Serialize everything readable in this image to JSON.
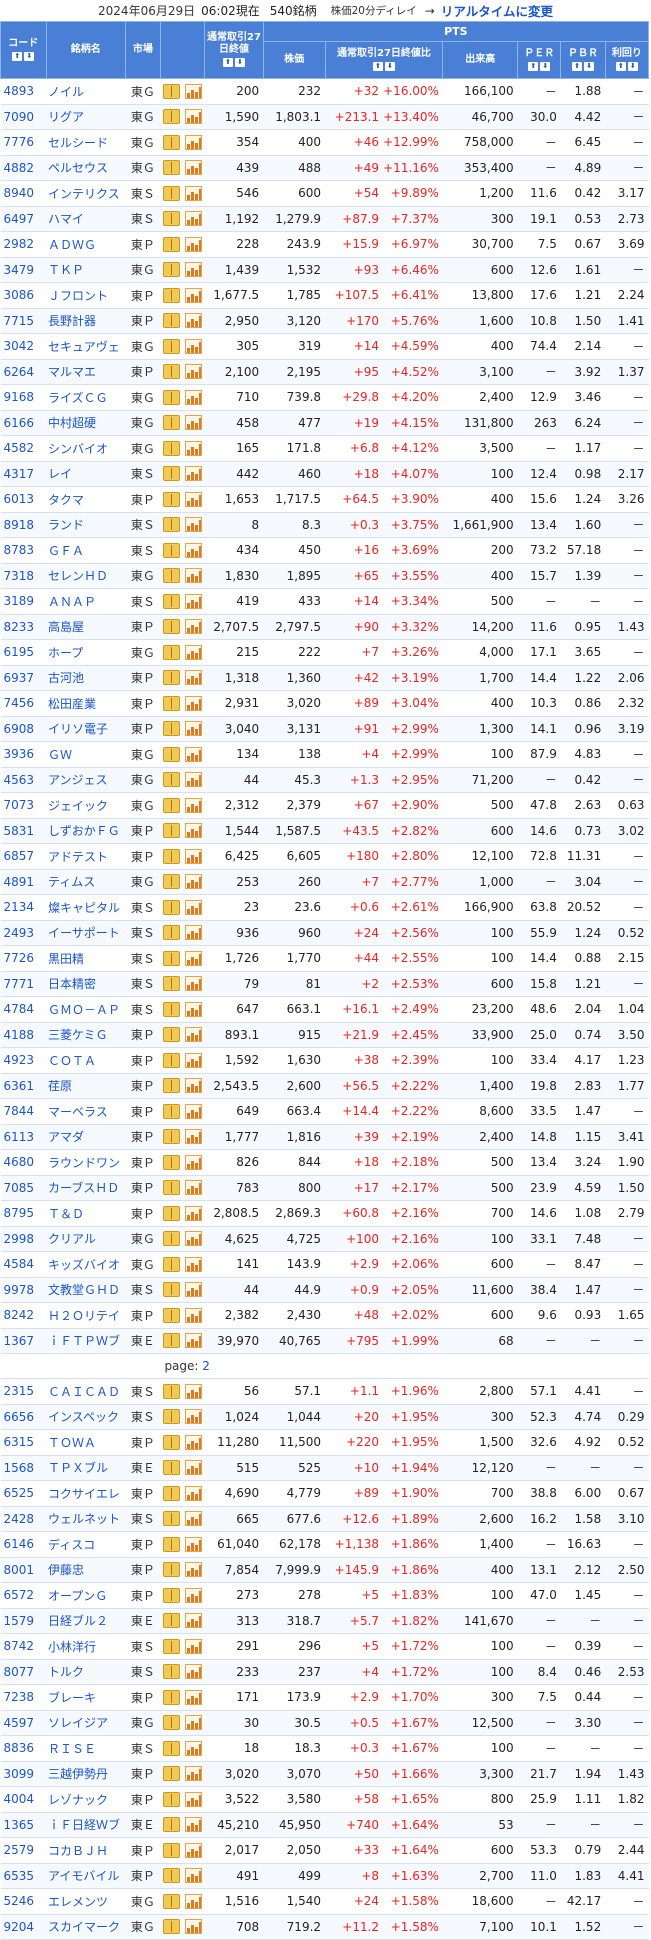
{
  "header": {
    "date": "2024年06月29日",
    "time": "06:02現在",
    "count": "540銘柄",
    "delay": "株価20分ディレイ",
    "arrow": "→",
    "realtime_link": "リアルタイムに変更"
  },
  "columns": {
    "code": "コード",
    "name": "銘柄名",
    "market": "市場",
    "prev_close": "通常取引27日終値",
    "pts_group": "PTS",
    "price": "株価",
    "change": "通常取引27日終値比",
    "volume": "出来高",
    "per": "ＰＥＲ",
    "pbr": "ＰＢＲ",
    "yield": "利回り",
    "sort_up": "⬆",
    "sort_down": "⬇"
  },
  "page_label": "page:",
  "page_link": "2",
  "rows": [
    {
      "code": "4893",
      "name": "ノイル",
      "market": "東Ｇ",
      "prev": "200",
      "price": "232",
      "chg": "+32",
      "pct": "+16.00%",
      "vol": "166,100",
      "per": "－",
      "pbr": "1.88",
      "yld": "－"
    },
    {
      "code": "7090",
      "name": "リグア",
      "market": "東Ｇ",
      "prev": "1,590",
      "price": "1,803.1",
      "chg": "+213.1",
      "pct": "+13.40%",
      "vol": "46,700",
      "per": "30.0",
      "pbr": "4.42",
      "yld": "－"
    },
    {
      "code": "7776",
      "name": "セルシード",
      "market": "東Ｇ",
      "prev": "354",
      "price": "400",
      "chg": "+46",
      "pct": "+12.99%",
      "vol": "758,000",
      "per": "－",
      "pbr": "6.45",
      "yld": "－"
    },
    {
      "code": "4882",
      "name": "ペルセウス",
      "market": "東Ｇ",
      "prev": "439",
      "price": "488",
      "chg": "+49",
      "pct": "+11.16%",
      "vol": "353,400",
      "per": "－",
      "pbr": "4.89",
      "yld": "－"
    },
    {
      "code": "8940",
      "name": "インテリクス",
      "market": "東Ｓ",
      "prev": "546",
      "price": "600",
      "chg": "+54",
      "pct": "+9.89%",
      "vol": "1,200",
      "per": "11.6",
      "pbr": "0.42",
      "yld": "3.17"
    },
    {
      "code": "6497",
      "name": "ハマイ",
      "market": "東Ｓ",
      "prev": "1,192",
      "price": "1,279.9",
      "chg": "+87.9",
      "pct": "+7.37%",
      "vol": "300",
      "per": "19.1",
      "pbr": "0.53",
      "yld": "2.73"
    },
    {
      "code": "2982",
      "name": "ＡＤＷＧ",
      "market": "東Ｐ",
      "prev": "228",
      "price": "243.9",
      "chg": "+15.9",
      "pct": "+6.97%",
      "vol": "30,700",
      "per": "7.5",
      "pbr": "0.67",
      "yld": "3.69"
    },
    {
      "code": "3479",
      "name": "ＴＫＰ",
      "market": "東Ｇ",
      "prev": "1,439",
      "price": "1,532",
      "chg": "+93",
      "pct": "+6.46%",
      "vol": "600",
      "per": "12.6",
      "pbr": "1.61",
      "yld": "－"
    },
    {
      "code": "3086",
      "name": "Ｊフロント",
      "market": "東Ｐ",
      "prev": "1,677.5",
      "price": "1,785",
      "chg": "+107.5",
      "pct": "+6.41%",
      "vol": "13,800",
      "per": "17.6",
      "pbr": "1.21",
      "yld": "2.24"
    },
    {
      "code": "7715",
      "name": "長野計器",
      "market": "東Ｐ",
      "prev": "2,950",
      "price": "3,120",
      "chg": "+170",
      "pct": "+5.76%",
      "vol": "1,600",
      "per": "10.8",
      "pbr": "1.50",
      "yld": "1.41"
    },
    {
      "code": "3042",
      "name": "セキュアヴェ",
      "market": "東Ｇ",
      "prev": "305",
      "price": "319",
      "chg": "+14",
      "pct": "+4.59%",
      "vol": "400",
      "per": "74.4",
      "pbr": "2.14",
      "yld": "－"
    },
    {
      "code": "6264",
      "name": "マルマエ",
      "market": "東Ｐ",
      "prev": "2,100",
      "price": "2,195",
      "chg": "+95",
      "pct": "+4.52%",
      "vol": "3,100",
      "per": "－",
      "pbr": "3.92",
      "yld": "1.37"
    },
    {
      "code": "9168",
      "name": "ライズＣＧ",
      "market": "東Ｇ",
      "prev": "710",
      "price": "739.8",
      "chg": "+29.8",
      "pct": "+4.20%",
      "vol": "2,400",
      "per": "12.9",
      "pbr": "3.46",
      "yld": "－"
    },
    {
      "code": "6166",
      "name": "中村超硬",
      "market": "東Ｇ",
      "prev": "458",
      "price": "477",
      "chg": "+19",
      "pct": "+4.15%",
      "vol": "131,800",
      "per": "263",
      "pbr": "6.24",
      "yld": "－"
    },
    {
      "code": "4582",
      "name": "シンバイオ",
      "market": "東Ｇ",
      "prev": "165",
      "price": "171.8",
      "chg": "+6.8",
      "pct": "+4.12%",
      "vol": "3,500",
      "per": "－",
      "pbr": "1.17",
      "yld": "－"
    },
    {
      "code": "4317",
      "name": "レイ",
      "market": "東Ｓ",
      "prev": "442",
      "price": "460",
      "chg": "+18",
      "pct": "+4.07%",
      "vol": "100",
      "per": "12.4",
      "pbr": "0.98",
      "yld": "2.17"
    },
    {
      "code": "6013",
      "name": "タクマ",
      "market": "東Ｐ",
      "prev": "1,653",
      "price": "1,717.5",
      "chg": "+64.5",
      "pct": "+3.90%",
      "vol": "400",
      "per": "15.6",
      "pbr": "1.24",
      "yld": "3.26"
    },
    {
      "code": "8918",
      "name": "ランド",
      "market": "東Ｓ",
      "prev": "8",
      "price": "8.3",
      "chg": "+0.3",
      "pct": "+3.75%",
      "vol": "1,661,900",
      "per": "13.4",
      "pbr": "1.60",
      "yld": "－"
    },
    {
      "code": "8783",
      "name": "ＧＦＡ",
      "market": "東Ｓ",
      "prev": "434",
      "price": "450",
      "chg": "+16",
      "pct": "+3.69%",
      "vol": "200",
      "per": "73.2",
      "pbr": "57.18",
      "yld": "－"
    },
    {
      "code": "7318",
      "name": "セレンＨＤ",
      "market": "東Ｇ",
      "prev": "1,830",
      "price": "1,895",
      "chg": "+65",
      "pct": "+3.55%",
      "vol": "400",
      "per": "15.7",
      "pbr": "1.39",
      "yld": "－"
    },
    {
      "code": "3189",
      "name": "ＡＮＡＰ",
      "market": "東Ｓ",
      "prev": "419",
      "price": "433",
      "chg": "+14",
      "pct": "+3.34%",
      "vol": "500",
      "per": "－",
      "pbr": "－",
      "yld": "－"
    },
    {
      "code": "8233",
      "name": "高島屋",
      "market": "東Ｐ",
      "prev": "2,707.5",
      "price": "2,797.5",
      "chg": "+90",
      "pct": "+3.32%",
      "vol": "14,200",
      "per": "11.6",
      "pbr": "0.95",
      "yld": "1.43"
    },
    {
      "code": "6195",
      "name": "ホープ",
      "market": "東Ｇ",
      "prev": "215",
      "price": "222",
      "chg": "+7",
      "pct": "+3.26%",
      "vol": "4,000",
      "per": "17.1",
      "pbr": "3.65",
      "yld": "－"
    },
    {
      "code": "6937",
      "name": "古河池",
      "market": "東Ｐ",
      "prev": "1,318",
      "price": "1,360",
      "chg": "+42",
      "pct": "+3.19%",
      "vol": "1,700",
      "per": "14.4",
      "pbr": "1.22",
      "yld": "2.06"
    },
    {
      "code": "7456",
      "name": "松田産業",
      "market": "東Ｐ",
      "prev": "2,931",
      "price": "3,020",
      "chg": "+89",
      "pct": "+3.04%",
      "vol": "400",
      "per": "10.3",
      "pbr": "0.86",
      "yld": "2.32"
    },
    {
      "code": "6908",
      "name": "イリソ電子",
      "market": "東Ｐ",
      "prev": "3,040",
      "price": "3,131",
      "chg": "+91",
      "pct": "+2.99%",
      "vol": "1,300",
      "per": "14.1",
      "pbr": "0.96",
      "yld": "3.19"
    },
    {
      "code": "3936",
      "name": "ＧＷ",
      "market": "東Ｇ",
      "prev": "134",
      "price": "138",
      "chg": "+4",
      "pct": "+2.99%",
      "vol": "100",
      "per": "87.9",
      "pbr": "4.83",
      "yld": "－"
    },
    {
      "code": "4563",
      "name": "アンジェス",
      "market": "東Ｇ",
      "prev": "44",
      "price": "45.3",
      "chg": "+1.3",
      "pct": "+2.95%",
      "vol": "71,200",
      "per": "－",
      "pbr": "0.42",
      "yld": "－"
    },
    {
      "code": "7073",
      "name": "ジェイック",
      "market": "東Ｇ",
      "prev": "2,312",
      "price": "2,379",
      "chg": "+67",
      "pct": "+2.90%",
      "vol": "500",
      "per": "47.8",
      "pbr": "2.63",
      "yld": "0.63"
    },
    {
      "code": "5831",
      "name": "しずおかＦＧ",
      "market": "東Ｐ",
      "prev": "1,544",
      "price": "1,587.5",
      "chg": "+43.5",
      "pct": "+2.82%",
      "vol": "600",
      "per": "14.6",
      "pbr": "0.73",
      "yld": "3.02"
    },
    {
      "code": "6857",
      "name": "アドテスト",
      "market": "東Ｐ",
      "prev": "6,425",
      "price": "6,605",
      "chg": "+180",
      "pct": "+2.80%",
      "vol": "12,100",
      "per": "72.8",
      "pbr": "11.31",
      "yld": "－"
    },
    {
      "code": "4891",
      "name": "ティムス",
      "market": "東Ｇ",
      "prev": "253",
      "price": "260",
      "chg": "+7",
      "pct": "+2.77%",
      "vol": "1,000",
      "per": "－",
      "pbr": "3.04",
      "yld": "－"
    },
    {
      "code": "2134",
      "name": "燦キャピタル",
      "market": "東Ｓ",
      "prev": "23",
      "price": "23.6",
      "chg": "+0.6",
      "pct": "+2.61%",
      "vol": "166,900",
      "per": "63.8",
      "pbr": "20.52",
      "yld": "－"
    },
    {
      "code": "2493",
      "name": "イーサポート",
      "market": "東Ｓ",
      "prev": "936",
      "price": "960",
      "chg": "+24",
      "pct": "+2.56%",
      "vol": "100",
      "per": "55.9",
      "pbr": "1.24",
      "yld": "0.52"
    },
    {
      "code": "7726",
      "name": "黒田精",
      "market": "東Ｓ",
      "prev": "1,726",
      "price": "1,770",
      "chg": "+44",
      "pct": "+2.55%",
      "vol": "100",
      "per": "14.4",
      "pbr": "0.88",
      "yld": "2.15"
    },
    {
      "code": "7771",
      "name": "日本精密",
      "market": "東Ｓ",
      "prev": "79",
      "price": "81",
      "chg": "+2",
      "pct": "+2.53%",
      "vol": "600",
      "per": "15.8",
      "pbr": "1.21",
      "yld": "－"
    },
    {
      "code": "4784",
      "name": "ＧＭＯ－ＡＰ",
      "market": "東Ｓ",
      "prev": "647",
      "price": "663.1",
      "chg": "+16.1",
      "pct": "+2.49%",
      "vol": "23,200",
      "per": "48.6",
      "pbr": "2.04",
      "yld": "1.04"
    },
    {
      "code": "4188",
      "name": "三菱ケミＧ",
      "market": "東Ｐ",
      "prev": "893.1",
      "price": "915",
      "chg": "+21.9",
      "pct": "+2.45%",
      "vol": "33,900",
      "per": "25.0",
      "pbr": "0.74",
      "yld": "3.50"
    },
    {
      "code": "4923",
      "name": "ＣＯＴＡ",
      "market": "東Ｐ",
      "prev": "1,592",
      "price": "1,630",
      "chg": "+38",
      "pct": "+2.39%",
      "vol": "100",
      "per": "33.4",
      "pbr": "4.17",
      "yld": "1.23"
    },
    {
      "code": "6361",
      "name": "荏原",
      "market": "東Ｐ",
      "prev": "2,543.5",
      "price": "2,600",
      "chg": "+56.5",
      "pct": "+2.22%",
      "vol": "1,400",
      "per": "19.8",
      "pbr": "2.83",
      "yld": "1.77"
    },
    {
      "code": "7844",
      "name": "マーベラス",
      "market": "東Ｐ",
      "prev": "649",
      "price": "663.4",
      "chg": "+14.4",
      "pct": "+2.22%",
      "vol": "8,600",
      "per": "33.5",
      "pbr": "1.47",
      "yld": "－"
    },
    {
      "code": "6113",
      "name": "アマダ",
      "market": "東Ｐ",
      "prev": "1,777",
      "price": "1,816",
      "chg": "+39",
      "pct": "+2.19%",
      "vol": "2,400",
      "per": "14.8",
      "pbr": "1.15",
      "yld": "3.41"
    },
    {
      "code": "4680",
      "name": "ラウンドワン",
      "market": "東Ｐ",
      "prev": "826",
      "price": "844",
      "chg": "+18",
      "pct": "+2.18%",
      "vol": "500",
      "per": "13.4",
      "pbr": "3.24",
      "yld": "1.90"
    },
    {
      "code": "7085",
      "name": "カーブスＨＤ",
      "market": "東Ｐ",
      "prev": "783",
      "price": "800",
      "chg": "+17",
      "pct": "+2.17%",
      "vol": "500",
      "per": "23.9",
      "pbr": "4.59",
      "yld": "1.50"
    },
    {
      "code": "8795",
      "name": "Ｔ＆Ｄ",
      "market": "東Ｐ",
      "prev": "2,808.5",
      "price": "2,869.3",
      "chg": "+60.8",
      "pct": "+2.16%",
      "vol": "700",
      "per": "14.6",
      "pbr": "1.08",
      "yld": "2.79"
    },
    {
      "code": "2998",
      "name": "クリアル",
      "market": "東Ｇ",
      "prev": "4,625",
      "price": "4,725",
      "chg": "+100",
      "pct": "+2.16%",
      "vol": "100",
      "per": "33.1",
      "pbr": "7.48",
      "yld": "－"
    },
    {
      "code": "4584",
      "name": "キッズバイオ",
      "market": "東Ｇ",
      "prev": "141",
      "price": "143.9",
      "chg": "+2.9",
      "pct": "+2.06%",
      "vol": "600",
      "per": "－",
      "pbr": "8.47",
      "yld": "－"
    },
    {
      "code": "9978",
      "name": "文教堂ＧＨＤ",
      "market": "東Ｓ",
      "prev": "44",
      "price": "44.9",
      "chg": "+0.9",
      "pct": "+2.05%",
      "vol": "11,600",
      "per": "38.4",
      "pbr": "1.47",
      "yld": "－"
    },
    {
      "code": "8242",
      "name": "Ｈ２Ｏリテイ",
      "market": "東Ｐ",
      "prev": "2,382",
      "price": "2,430",
      "chg": "+48",
      "pct": "+2.02%",
      "vol": "600",
      "per": "9.6",
      "pbr": "0.93",
      "yld": "1.65"
    },
    {
      "code": "1367",
      "name": "ｉＦＴＰＷブ",
      "market": "東Ｅ",
      "prev": "39,970",
      "price": "40,765",
      "chg": "+795",
      "pct": "+1.99%",
      "vol": "68",
      "per": "－",
      "pbr": "－",
      "yld": "－"
    }
  ],
  "rows2": [
    {
      "code": "2315",
      "name": "ＣＡＩＣＡＤ",
      "market": "東Ｓ",
      "prev": "56",
      "price": "57.1",
      "chg": "+1.1",
      "pct": "+1.96%",
      "vol": "2,800",
      "per": "57.1",
      "pbr": "4.41",
      "yld": "－"
    },
    {
      "code": "6656",
      "name": "インスペック",
      "market": "東Ｓ",
      "prev": "1,024",
      "price": "1,044",
      "chg": "+20",
      "pct": "+1.95%",
      "vol": "300",
      "per": "52.3",
      "pbr": "4.74",
      "yld": "0.29"
    },
    {
      "code": "6315",
      "name": "ＴＯＷＡ",
      "market": "東Ｐ",
      "prev": "11,280",
      "price": "11,500",
      "chg": "+220",
      "pct": "+1.95%",
      "vol": "1,500",
      "per": "32.6",
      "pbr": "4.92",
      "yld": "0.52"
    },
    {
      "code": "1568",
      "name": "ＴＰＸブル",
      "market": "東Ｅ",
      "prev": "515",
      "price": "525",
      "chg": "+10",
      "pct": "+1.94%",
      "vol": "12,120",
      "per": "－",
      "pbr": "－",
      "yld": "－"
    },
    {
      "code": "6525",
      "name": "コクサイエレ",
      "market": "東Ｐ",
      "prev": "4,690",
      "price": "4,779",
      "chg": "+89",
      "pct": "+1.90%",
      "vol": "700",
      "per": "38.8",
      "pbr": "6.00",
      "yld": "0.67"
    },
    {
      "code": "2428",
      "name": "ウェルネット",
      "market": "東Ｓ",
      "prev": "665",
      "price": "677.6",
      "chg": "+12.6",
      "pct": "+1.89%",
      "vol": "2,600",
      "per": "16.2",
      "pbr": "1.58",
      "yld": "3.10"
    },
    {
      "code": "6146",
      "name": "ディスコ",
      "market": "東Ｐ",
      "prev": "61,040",
      "price": "62,178",
      "chg": "+1,138",
      "pct": "+1.86%",
      "vol": "1,400",
      "per": "－",
      "pbr": "16.63",
      "yld": "－"
    },
    {
      "code": "8001",
      "name": "伊藤忠",
      "market": "東Ｐ",
      "prev": "7,854",
      "price": "7,999.9",
      "chg": "+145.9",
      "pct": "+1.86%",
      "vol": "400",
      "per": "13.1",
      "pbr": "2.12",
      "yld": "2.50"
    },
    {
      "code": "6572",
      "name": "オープンＧ",
      "market": "東Ｐ",
      "prev": "273",
      "price": "278",
      "chg": "+5",
      "pct": "+1.83%",
      "vol": "100",
      "per": "47.0",
      "pbr": "1.45",
      "yld": "－"
    },
    {
      "code": "1579",
      "name": "日経ブル２",
      "market": "東Ｅ",
      "prev": "313",
      "price": "318.7",
      "chg": "+5.7",
      "pct": "+1.82%",
      "vol": "141,670",
      "per": "－",
      "pbr": "－",
      "yld": "－"
    },
    {
      "code": "8742",
      "name": "小林洋行",
      "market": "東Ｓ",
      "prev": "291",
      "price": "296",
      "chg": "+5",
      "pct": "+1.72%",
      "vol": "100",
      "per": "－",
      "pbr": "0.39",
      "yld": "－"
    },
    {
      "code": "8077",
      "name": "トルク",
      "market": "東Ｓ",
      "prev": "233",
      "price": "237",
      "chg": "+4",
      "pct": "+1.72%",
      "vol": "100",
      "per": "8.4",
      "pbr": "0.46",
      "yld": "2.53"
    },
    {
      "code": "7238",
      "name": "ブレーキ",
      "market": "東Ｐ",
      "prev": "171",
      "price": "173.9",
      "chg": "+2.9",
      "pct": "+1.70%",
      "vol": "300",
      "per": "7.5",
      "pbr": "0.44",
      "yld": "－"
    },
    {
      "code": "4597",
      "name": "ソレイジア",
      "market": "東Ｇ",
      "prev": "30",
      "price": "30.5",
      "chg": "+0.5",
      "pct": "+1.67%",
      "vol": "12,500",
      "per": "－",
      "pbr": "3.30",
      "yld": "－"
    },
    {
      "code": "8836",
      "name": "ＲＩＳＥ",
      "market": "東Ｓ",
      "prev": "18",
      "price": "18.3",
      "chg": "+0.3",
      "pct": "+1.67%",
      "vol": "100",
      "per": "－",
      "pbr": "－",
      "yld": "－"
    },
    {
      "code": "3099",
      "name": "三越伊勢丹",
      "market": "東Ｐ",
      "prev": "3,020",
      "price": "3,070",
      "chg": "+50",
      "pct": "+1.66%",
      "vol": "3,300",
      "per": "21.7",
      "pbr": "1.94",
      "yld": "1.43"
    },
    {
      "code": "4004",
      "name": "レゾナック",
      "market": "東Ｐ",
      "prev": "3,522",
      "price": "3,580",
      "chg": "+58",
      "pct": "+1.65%",
      "vol": "800",
      "per": "25.9",
      "pbr": "1.11",
      "yld": "1.82"
    },
    {
      "code": "1365",
      "name": "ｉＦ日経Ｗブ",
      "market": "東Ｅ",
      "prev": "45,210",
      "price": "45,950",
      "chg": "+740",
      "pct": "+1.64%",
      "vol": "53",
      "per": "－",
      "pbr": "－",
      "yld": "－"
    },
    {
      "code": "2579",
      "name": "コカＢＪＨ",
      "market": "東Ｐ",
      "prev": "2,017",
      "price": "2,050",
      "chg": "+33",
      "pct": "+1.64%",
      "vol": "600",
      "per": "53.3",
      "pbr": "0.79",
      "yld": "2.44"
    },
    {
      "code": "6535",
      "name": "アイモバイル",
      "market": "東Ｐ",
      "prev": "491",
      "price": "499",
      "chg": "+8",
      "pct": "+1.63%",
      "vol": "2,700",
      "per": "11.0",
      "pbr": "1.83",
      "yld": "4.41"
    },
    {
      "code": "5246",
      "name": "エレメンツ",
      "market": "東Ｇ",
      "prev": "1,516",
      "price": "1,540",
      "chg": "+24",
      "pct": "+1.58%",
      "vol": "18,600",
      "per": "－",
      "pbr": "42.17",
      "yld": "－"
    },
    {
      "code": "9204",
      "name": "スカイマーク",
      "market": "東Ｇ",
      "prev": "708",
      "price": "719.2",
      "chg": "+11.2",
      "pct": "+1.58%",
      "vol": "7,100",
      "per": "10.1",
      "pbr": "1.52",
      "yld": "－"
    }
  ]
}
